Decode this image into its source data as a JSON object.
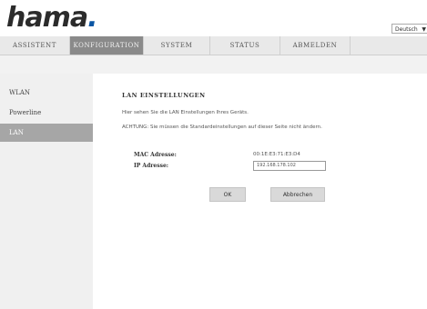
{
  "brand": {
    "logo_text": "hama",
    "logo_dot": "."
  },
  "language": {
    "selected": "Deutsch"
  },
  "nav": {
    "tabs": [
      {
        "label": "ASSISTENT"
      },
      {
        "label": "KONFIGURATION"
      },
      {
        "label": "SYSTEM"
      },
      {
        "label": "STATUS"
      },
      {
        "label": "ABMELDEN"
      }
    ],
    "active_tab": "KONFIGURATION"
  },
  "sidebar": {
    "items": [
      {
        "label": "WLAN"
      },
      {
        "label": "Powerline"
      },
      {
        "label": "LAN"
      }
    ],
    "active_item": "LAN"
  },
  "main": {
    "title": "LAN EINSTELLUNGEN",
    "description": "Hier sehen Sie die LAN Einstellungen Ihres Geräts.",
    "warning": "ACHTUNG: Sie müssen die Standardeinstellungen auf dieser Seite nicht ändern.",
    "mac_label": "MAC Adresse:",
    "mac_value": "00:1E:E3:71:E3:D4",
    "ip_label": "IP Adresse:",
    "ip_value": "192.168.178.102",
    "ok_label": "OK",
    "cancel_label": "Abbrechen"
  },
  "colors": {
    "active_tab": "#8a8a8a",
    "active_side": "#a6a6a6",
    "logo_dot": "#0a56a4"
  }
}
